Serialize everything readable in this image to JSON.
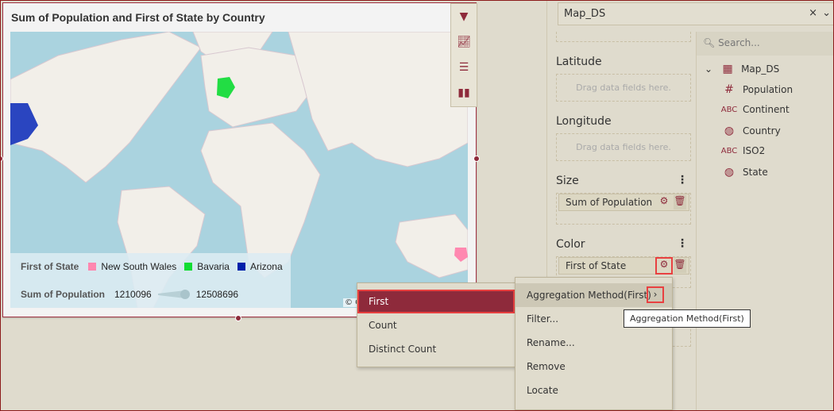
{
  "widget": {
    "title": "Sum of Population and First of State by Country",
    "toolbar_icons": [
      "filter-icon",
      "chart-type-icon",
      "properties-icon",
      "chart-icon"
    ],
    "legend": {
      "color_title": "First of State",
      "items": [
        {
          "label": "New South Wales",
          "color": "#ff88b0"
        },
        {
          "label": "Bavaria",
          "color": "#11dd33"
        },
        {
          "label": "Arizona",
          "color": "#0020aa"
        }
      ],
      "size_title": "Sum of Population",
      "size_min": "1210096",
      "size_max": "12508696"
    },
    "copyright": "© O"
  },
  "datasource": {
    "selected": "Map_DS",
    "clear": "×",
    "chevron": "⌄"
  },
  "config": {
    "latitude": "Latitude",
    "longitude": "Longitude",
    "size": "Size",
    "color": "Color",
    "drop_hint": "Drag data fields here.",
    "size_field": "Sum of Population",
    "color_field": "First of State",
    "kebab": "⋮"
  },
  "fields": {
    "search_placeholder": "Search...",
    "root": "Map_DS",
    "items": [
      {
        "type": "#",
        "label": "Population"
      },
      {
        "type": "ABC",
        "label": "Continent"
      },
      {
        "type": "globe",
        "label": "Country"
      },
      {
        "type": "ABC",
        "label": "ISO2"
      },
      {
        "type": "globe",
        "label": "State"
      }
    ]
  },
  "context_menu": {
    "items": [
      "Aggregation Method(First)",
      "Filter...",
      "Rename...",
      "Remove",
      "Locate"
    ],
    "arrow": "›"
  },
  "submenu": {
    "items": [
      "First",
      "Count",
      "Distinct Count"
    ],
    "selected": "First"
  },
  "tooltip": "Aggregation Method(First)",
  "colors": {
    "accent": "#8e2a3b",
    "highlight": "#e84040"
  }
}
